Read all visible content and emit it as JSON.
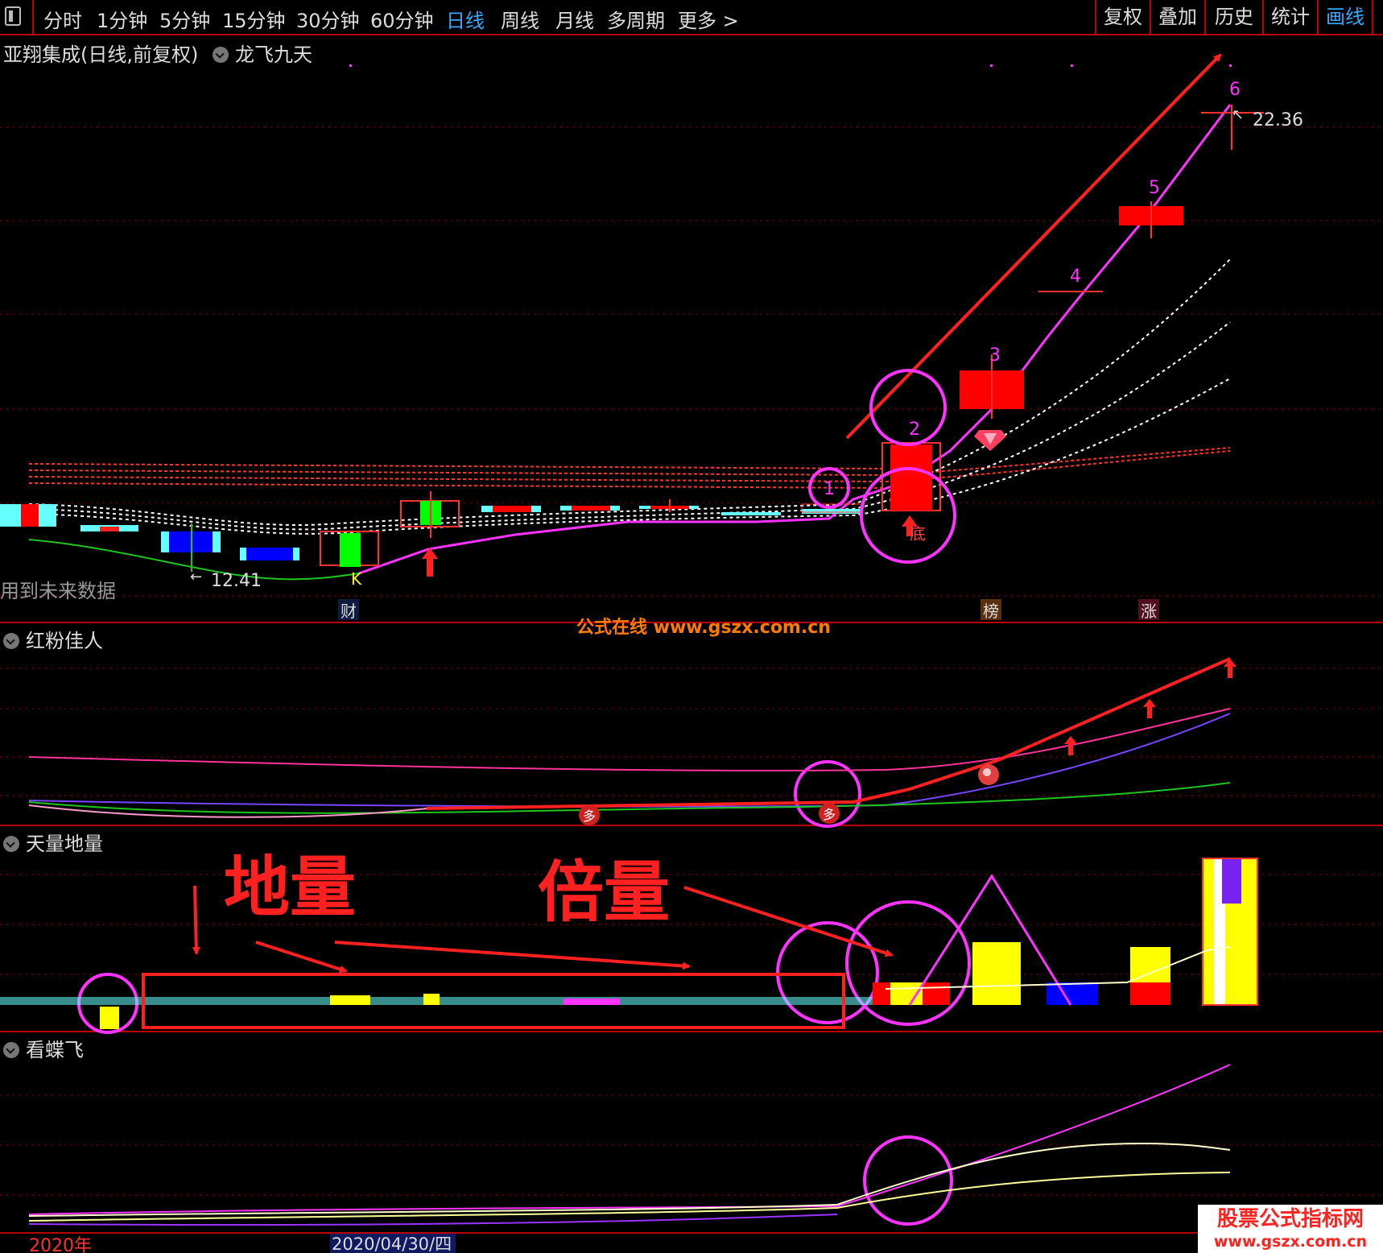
{
  "toolbar": {
    "tabs": [
      "分时",
      "1分钟",
      "5分钟",
      "15分钟",
      "30分钟",
      "60分钟",
      "日线",
      "周线",
      "月线",
      "多周期",
      "更多 >"
    ],
    "active_tab": "日线",
    "right_tabs": [
      "复权",
      "叠加",
      "历史",
      "统计",
      "画线"
    ],
    "active_right_tab": "画线"
  },
  "main_panel": {
    "stock_title": "亚翔集成(日线,前复权)",
    "indicator": "龙飞九天",
    "warning": "用到未来数据",
    "price_high": "22.36",
    "price_low": "12.41",
    "wave_labels": [
      "1",
      "2",
      "3",
      "4",
      "5",
      "6"
    ],
    "markers": {
      "k": "K",
      "di": "底",
      "cai": "财",
      "bang": "榜",
      "zhang": "涨"
    },
    "watermark": "公式在线 www.gszx.com.cn"
  },
  "panel2": {
    "title": "红粉佳人",
    "badge": "多"
  },
  "panel3": {
    "title": "天量地量",
    "annot_left": "地量",
    "annot_right": "倍量"
  },
  "panel4": {
    "title": "看蝶飞"
  },
  "footer": {
    "year": "2020年",
    "date": "2020/04/30/四"
  },
  "brand": {
    "name": "股票公式指标网",
    "url": "www.gszx.com.cn"
  },
  "colors": {
    "up": "#ff0000",
    "down_green": "#00ff00",
    "down_blue": "#0000ff",
    "cyan": "#66ffff",
    "magenta": "#ff33ff",
    "divider": "#bb0000",
    "active_tab": "#36a9ff",
    "yellow": "#ffff00"
  }
}
